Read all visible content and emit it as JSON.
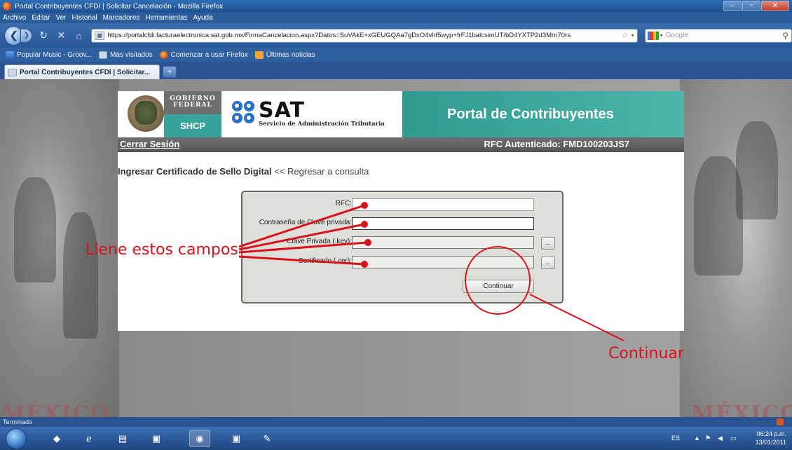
{
  "browser": {
    "window_title": "Portal Contribuyentes CFDI | Solicitar Cancelación - Mozilla Firefox",
    "menu": [
      "Archivo",
      "Editar",
      "Ver",
      "Historial",
      "Marcadores",
      "Herramientas",
      "Ayuda"
    ],
    "url": "https://portalcfdi.facturaelectronica.sat.gob.mx/FirmaCancelacion.aspx?Datos=SuVAkE+xGEUGQAa7gDxO4vhf5wyp+frFJ1balcsimUT/bD4YXTP2d3Mrn70rs",
    "search_placeholder": "Google",
    "bookmarks": [
      "Popular Music - Groov...",
      "Más visitados",
      "Comenzar a usar Firefox",
      "Últimas noticias"
    ],
    "tab_label": "Portal Contribuyentes CFDI | Solicitar...",
    "status": "Terminado"
  },
  "header": {
    "gobierno_line1": "GOBIERNO",
    "gobierno_line2": "FEDERAL",
    "shcp": "SHCP",
    "sat": "SAT",
    "sat_subtitle": "Servicio de Administración Tributaria",
    "portal_title": "Portal de Contribuyentes"
  },
  "session_bar": {
    "logout": "Cerrar Sesión",
    "rfc_auth": "RFC Autenticado: FMD100203JS7"
  },
  "page": {
    "heading": "Ingresar Certificado de Sello Digital",
    "back_link": "<< Regresar a consulta"
  },
  "form": {
    "rfc_label": "RFC:",
    "password_label": "Contraseña de Clave privada:",
    "key_label": "Clave Privada (.key):",
    "cert_label": "Certificado (.cer):",
    "browse": "...",
    "submit": "Continuar"
  },
  "annotations": {
    "fill_fields": "Llene estos campos",
    "continue": "Continuar",
    "color": "#d8121a"
  },
  "watermark": "MÉXICO",
  "taskbar": {
    "lang": "ES",
    "time": "06:24 p.m.",
    "date": "13/01/2011"
  }
}
